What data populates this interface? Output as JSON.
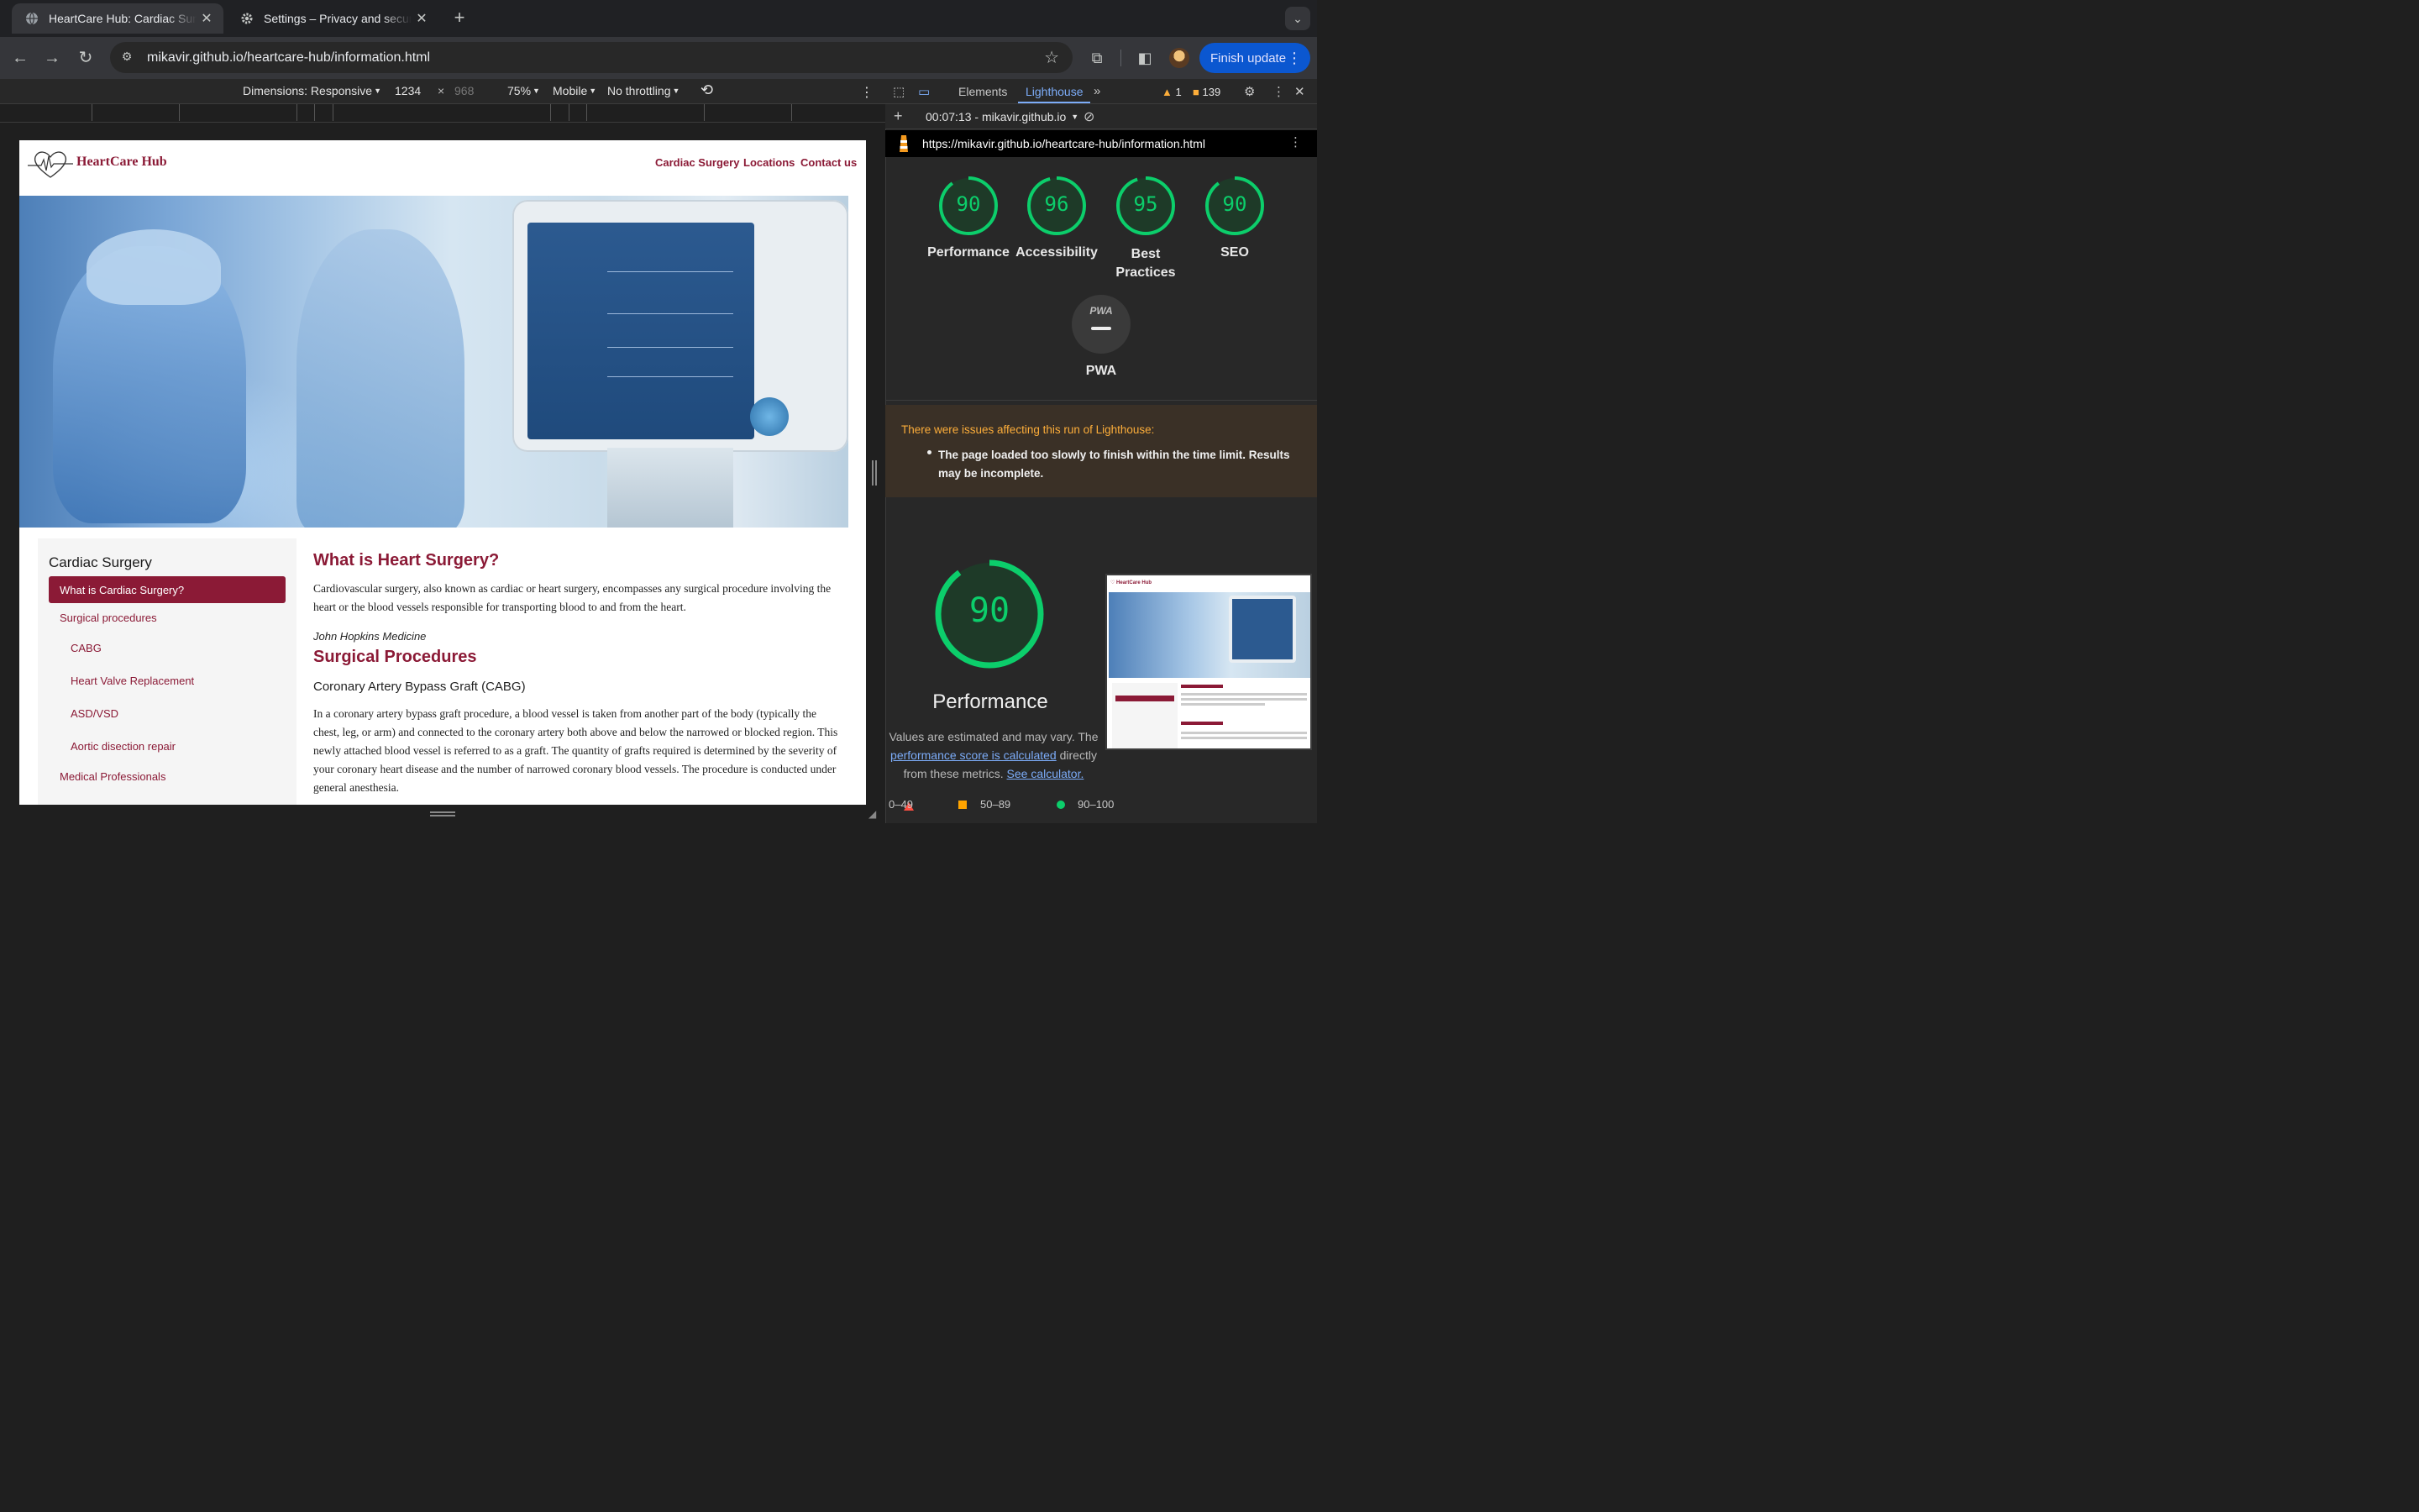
{
  "browser": {
    "tabs": [
      {
        "title": "HeartCare Hub: Cardiac Surgery"
      },
      {
        "title": "Settings – Privacy and security"
      }
    ],
    "url": "mikavir.github.io/heartcare-hub/information.html",
    "finish_update": "Finish update"
  },
  "device_toolbar": {
    "dimensions": "Dimensions: Responsive",
    "width": "1234",
    "times": "×",
    "height": "968",
    "zoom": "75%",
    "device": "Mobile",
    "throttling": "No throttling"
  },
  "site": {
    "brand": "HeartCare Hub",
    "nav": [
      "Cardiac Surgery",
      "Locations",
      "Contact us"
    ],
    "sidebar": {
      "title": "Cardiac Surgery",
      "active": "What is Cardiac Surgery?",
      "items": [
        "Surgical procedures",
        "CABG",
        "Heart Valve Replacement",
        "ASD/VSD",
        "Aortic disection repair",
        "Medical Professionals"
      ]
    },
    "article": {
      "h1": "What is Heart Surgery?",
      "p1": "Cardiovascular surgery, also known as cardiac or heart surgery, encompasses any surgical procedure involving the heart or the blood vessels responsible for transporting blood to and from the heart.",
      "cite": "John Hopkins Medicine",
      "h2": "Surgical Procedures",
      "h3": "Coronary Artery Bypass Graft (CABG)",
      "p2": "In a coronary artery bypass graft procedure, a blood vessel is taken from another part of the body (typically the chest, leg, or arm) and connected to the coronary artery both above and below the narrowed or blocked region. This newly attached blood vessel is referred to as a graft. The quantity of grafts required is determined by the severity of your coronary heart disease and the number of narrowed coronary blood vessels. The procedure is conducted under general anesthesia."
    }
  },
  "devtools": {
    "tabs": [
      "Elements",
      "Lighthouse"
    ],
    "warnings": "1",
    "issues": "139",
    "report_time": "00:07:13 - mikavir.github.io",
    "report_url": "https://mikavir.github.io/heartcare-hub/information.html",
    "scores": [
      {
        "label": "Performance",
        "value": "90"
      },
      {
        "label": "Accessibility",
        "value": "96"
      },
      {
        "label": "Best Practices",
        "value": "95"
      },
      {
        "label": "SEO",
        "value": "90"
      }
    ],
    "pwa": {
      "label": "PWA",
      "badge": "PWA"
    },
    "issues_box": {
      "title": "There were issues affecting this run of Lighthouse:",
      "item": "The page loaded too slowly to finish within the time limit. Results may be incomplete."
    },
    "performance": {
      "value": "90",
      "label": "Performance",
      "note_1": "Values are estimated and may vary. The",
      "note_link_1": "performance score is calculated",
      "note_2": "directly from these metrics.",
      "note_link_2": "See calculator."
    },
    "legend": [
      "0–49",
      "50–89",
      "90–100"
    ],
    "colors": {
      "pass": "#0cce6b",
      "average": "#ffa400",
      "fail": "#ff4e42",
      "accent": "#8b1a36"
    }
  }
}
